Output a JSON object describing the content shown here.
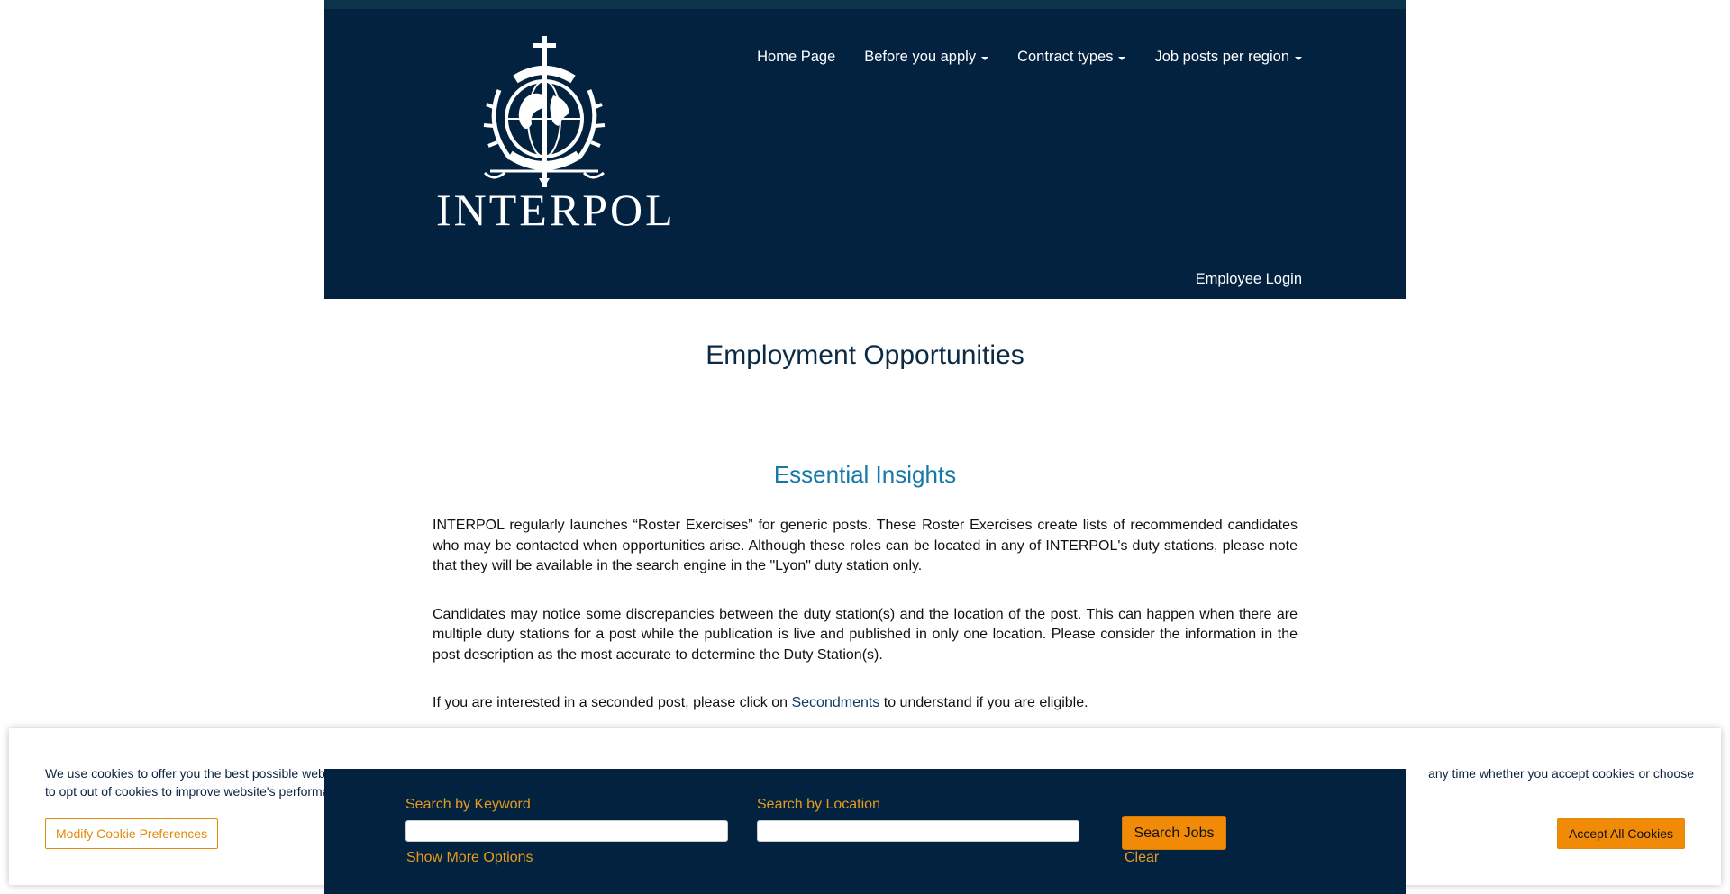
{
  "header": {
    "logo_seal_text": "OIPC ICPO INTERPOL",
    "logo_text": "INTERPOL",
    "nav": [
      {
        "label": "Home Page",
        "dropdown": false
      },
      {
        "label": "Before you apply",
        "dropdown": true
      },
      {
        "label": "Contract types",
        "dropdown": true
      },
      {
        "label": "Job posts per region",
        "dropdown": true
      }
    ],
    "employee_login": "Employee Login"
  },
  "main": {
    "page_title": "Employment Opportunities",
    "section_title": "Essential Insights",
    "paragraph1": "INTERPOL regularly launches “Roster Exercises” for generic posts. These Roster Exercises create lists of recommended candidates who may be contacted when opportunities arise. Although these roles can be located in any of INTERPOL's duty stations, please note that they will be available in the search engine in the \"Lyon\" duty station only.",
    "paragraph2": "Candidates may notice some discrepancies between the duty station(s) and the location of the post. This can happen when there are multiple duty stations for a post while the publication is live and published in only one location. Please consider the information in the post description as the most accurate to determine the Duty Station(s).",
    "paragraph3_before": "If you are interested in a seconded post, please click on ",
    "paragraph3_link": "Secondments",
    "paragraph3_after": " to understand if you are eligible."
  },
  "cookie": {
    "line1_start": "We use cookies to offer you the best possible web",
    "line1_end": " any time whether you accept cookies or choose",
    "line2_start": "to opt out of cookies to improve website's performa",
    "modify_label": "Modify Cookie Preferences",
    "accept_label": "Accept All Cookies"
  },
  "search": {
    "keyword_label": "Search by Keyword",
    "keyword_value": "",
    "location_label": "Search by Location",
    "location_value": "",
    "search_button": "Search Jobs",
    "more_options": "Show More Options",
    "clear": "Clear"
  },
  "colors": {
    "header_bg": "#022240",
    "accent_orange": "#f08a07",
    "section_title": "#1679a7"
  }
}
